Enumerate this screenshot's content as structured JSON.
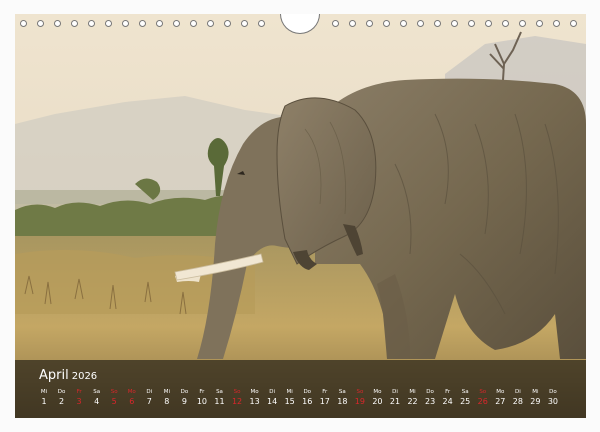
{
  "calendar": {
    "month": "April",
    "year": "2026",
    "days": [
      {
        "wd": "Mi",
        "dn": "1",
        "holiday": false
      },
      {
        "wd": "Do",
        "dn": "2",
        "holiday": false
      },
      {
        "wd": "Fr",
        "dn": "3",
        "holiday": true
      },
      {
        "wd": "Sa",
        "dn": "4",
        "holiday": false
      },
      {
        "wd": "So",
        "dn": "5",
        "holiday": true
      },
      {
        "wd": "Mo",
        "dn": "6",
        "holiday": true
      },
      {
        "wd": "Di",
        "dn": "7",
        "holiday": false
      },
      {
        "wd": "Mi",
        "dn": "8",
        "holiday": false
      },
      {
        "wd": "Do",
        "dn": "9",
        "holiday": false
      },
      {
        "wd": "Fr",
        "dn": "10",
        "holiday": false
      },
      {
        "wd": "Sa",
        "dn": "11",
        "holiday": false
      },
      {
        "wd": "So",
        "dn": "12",
        "holiday": true
      },
      {
        "wd": "Mo",
        "dn": "13",
        "holiday": false
      },
      {
        "wd": "Di",
        "dn": "14",
        "holiday": false
      },
      {
        "wd": "Mi",
        "dn": "15",
        "holiday": false
      },
      {
        "wd": "Do",
        "dn": "16",
        "holiday": false
      },
      {
        "wd": "Fr",
        "dn": "17",
        "holiday": false
      },
      {
        "wd": "Sa",
        "dn": "18",
        "holiday": false
      },
      {
        "wd": "So",
        "dn": "19",
        "holiday": true
      },
      {
        "wd": "Mo",
        "dn": "20",
        "holiday": false
      },
      {
        "wd": "Di",
        "dn": "21",
        "holiday": false
      },
      {
        "wd": "Mi",
        "dn": "22",
        "holiday": false
      },
      {
        "wd": "Do",
        "dn": "23",
        "holiday": false
      },
      {
        "wd": "Fr",
        "dn": "24",
        "holiday": false
      },
      {
        "wd": "Sa",
        "dn": "25",
        "holiday": false
      },
      {
        "wd": "So",
        "dn": "26",
        "holiday": true
      },
      {
        "wd": "Mo",
        "dn": "27",
        "holiday": false
      },
      {
        "wd": "Di",
        "dn": "28",
        "holiday": false
      },
      {
        "wd": "Mi",
        "dn": "29",
        "holiday": false
      },
      {
        "wd": "Do",
        "dn": "30",
        "holiday": false
      }
    ]
  },
  "colors": {
    "sky": "#e9d9c0",
    "grass": "#b59a55",
    "elephant": "#7a6e5a",
    "bar": "#1a1712",
    "holiday": "#d9262b"
  }
}
